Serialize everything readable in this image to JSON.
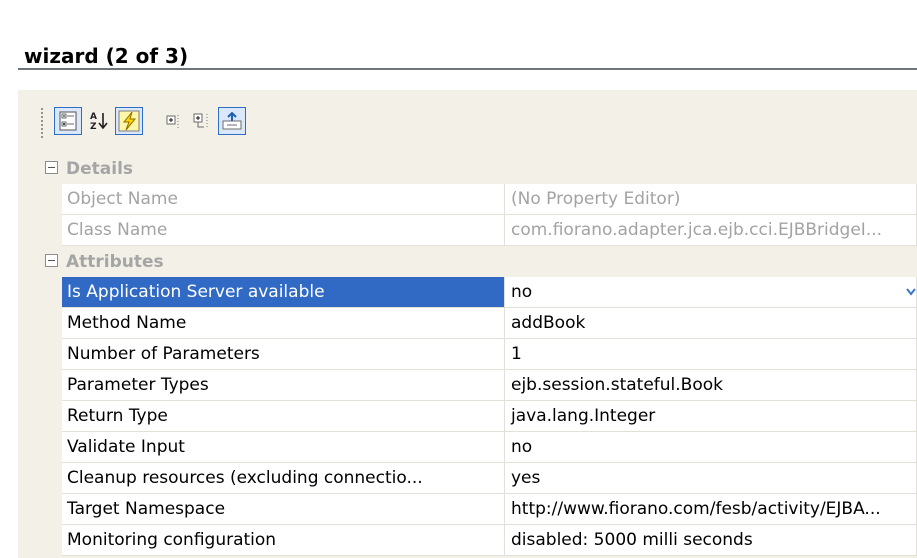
{
  "wizard": {
    "title": "wizard (2 of 3)"
  },
  "toolbar": {
    "buttons": [
      {
        "name": "categorized-view-button",
        "icon": "categorized-view-icon",
        "active": true
      },
      {
        "name": "alphabetical-sort-button",
        "icon": "alphabetical-sort-icon",
        "active": false
      },
      {
        "name": "show-events-button",
        "icon": "lightning-icon",
        "active": true
      },
      {
        "name": "collapse-all-button",
        "icon": "collapse-all-icon",
        "active": false
      },
      {
        "name": "expand-all-button",
        "icon": "expand-all-icon",
        "active": false
      },
      {
        "name": "property-editor-button",
        "icon": "property-editor-icon",
        "active": true
      }
    ]
  },
  "properties": {
    "categories": [
      {
        "label": "Details",
        "rows": [
          {
            "name": "Object Name",
            "value": "(No Property Editor)",
            "readonly": true
          },
          {
            "name": "Class Name",
            "value": "com.fiorano.adapter.jca.ejb.cci.EJBBridgeI...",
            "readonly": true
          }
        ]
      },
      {
        "label": "Attributes",
        "rows": [
          {
            "name": "Is Application Server available",
            "value": "no",
            "selected": true,
            "has_dropdown": true
          },
          {
            "name": "Method Name",
            "value": "addBook"
          },
          {
            "name": "Number of Parameters",
            "value": "1"
          },
          {
            "name": "Parameter Types",
            "value": "ejb.session.stateful.Book"
          },
          {
            "name": "Return Type",
            "value": "java.lang.Integer"
          },
          {
            "name": "Validate Input",
            "value": "no"
          },
          {
            "name": "Cleanup resources (excluding connectio...",
            "value": "yes"
          },
          {
            "name": "Target Namespace",
            "value": "http://www.fiorano.com/fesb/activity/EJBA..."
          },
          {
            "name": "Monitoring configuration",
            "value": "disabled: 5000 milli seconds"
          }
        ]
      }
    ]
  },
  "colors": {
    "panel_bg": "#f3f1e7",
    "selected_bg": "#316ac5",
    "readonly_text": "#a3a3a3",
    "category_text": "#a5a5a5",
    "active_button_border": "#2e6ec6"
  }
}
